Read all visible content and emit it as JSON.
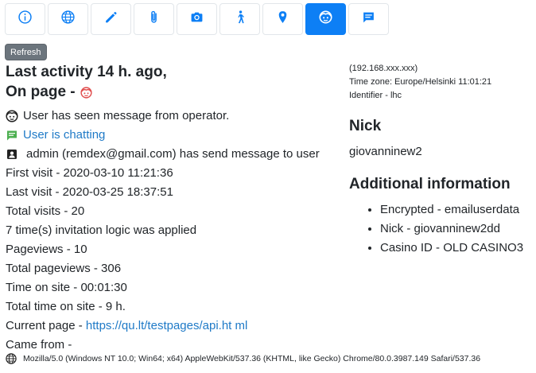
{
  "toolbar": {
    "buttons": [
      {
        "icon": "info-icon",
        "active": false
      },
      {
        "icon": "globe-icon",
        "active": false
      },
      {
        "icon": "pencil-icon",
        "active": false
      },
      {
        "icon": "paperclip-icon",
        "active": false
      },
      {
        "icon": "camera-icon",
        "active": false
      },
      {
        "icon": "walking-person-icon",
        "active": false
      },
      {
        "icon": "map-pin-icon",
        "active": false
      },
      {
        "icon": "face-icon",
        "active": true
      },
      {
        "icon": "chat-icon",
        "active": false
      }
    ],
    "accent": "#0d7ff5"
  },
  "refresh_label": "Refresh",
  "activity": {
    "line1": "Last activity 14 h. ago,",
    "line2": "On page -"
  },
  "details": {
    "seen_message": "User has seen message from operator.",
    "chatting": "User is chatting",
    "admin_message": "admin (remdex@gmail.com) has send message to user",
    "first_visit": "First visit - 2020-03-10 11:21:36",
    "last_visit": "Last visit - 2020-03-25 18:37:51",
    "total_visits": "Total visits - 20",
    "invitation": "7 time(s) invitation logic was applied",
    "pageviews": "Pageviews - 10",
    "total_pageviews": "Total pageviews - 306",
    "time_on_site": "Time on site - 00:01:30",
    "total_time": "Total time on site - 9 h.",
    "current_page_label": "Current page -",
    "current_page_url": "https://qu.lt/testpages/api.ht ml",
    "came_from": "Came from -"
  },
  "user_agent": "Mozilla/5.0 (Windows NT 10.0; Win64; x64) AppleWebKit/537.36 (KHTML, like Gecko) Chrome/80.0.3987.149 Safari/537.36",
  "side": {
    "ip": "(192.168.xxx.xxx)",
    "timezone": "Time zone: Europe/Helsinki 11:01:21",
    "identifier": "Identifier - lhc",
    "nick_heading": "Nick",
    "nick_value": "giovanninew2",
    "additional_heading": "Additional information",
    "additional_items": [
      "Encrypted - emailuserdata",
      "Nick - giovanninew2dd",
      "Casino ID - OLD CASINO3"
    ]
  },
  "colors": {
    "link": "#1f7ac7",
    "chat_icon": "#4caf50",
    "face_icon_red": "#e04b4b"
  }
}
